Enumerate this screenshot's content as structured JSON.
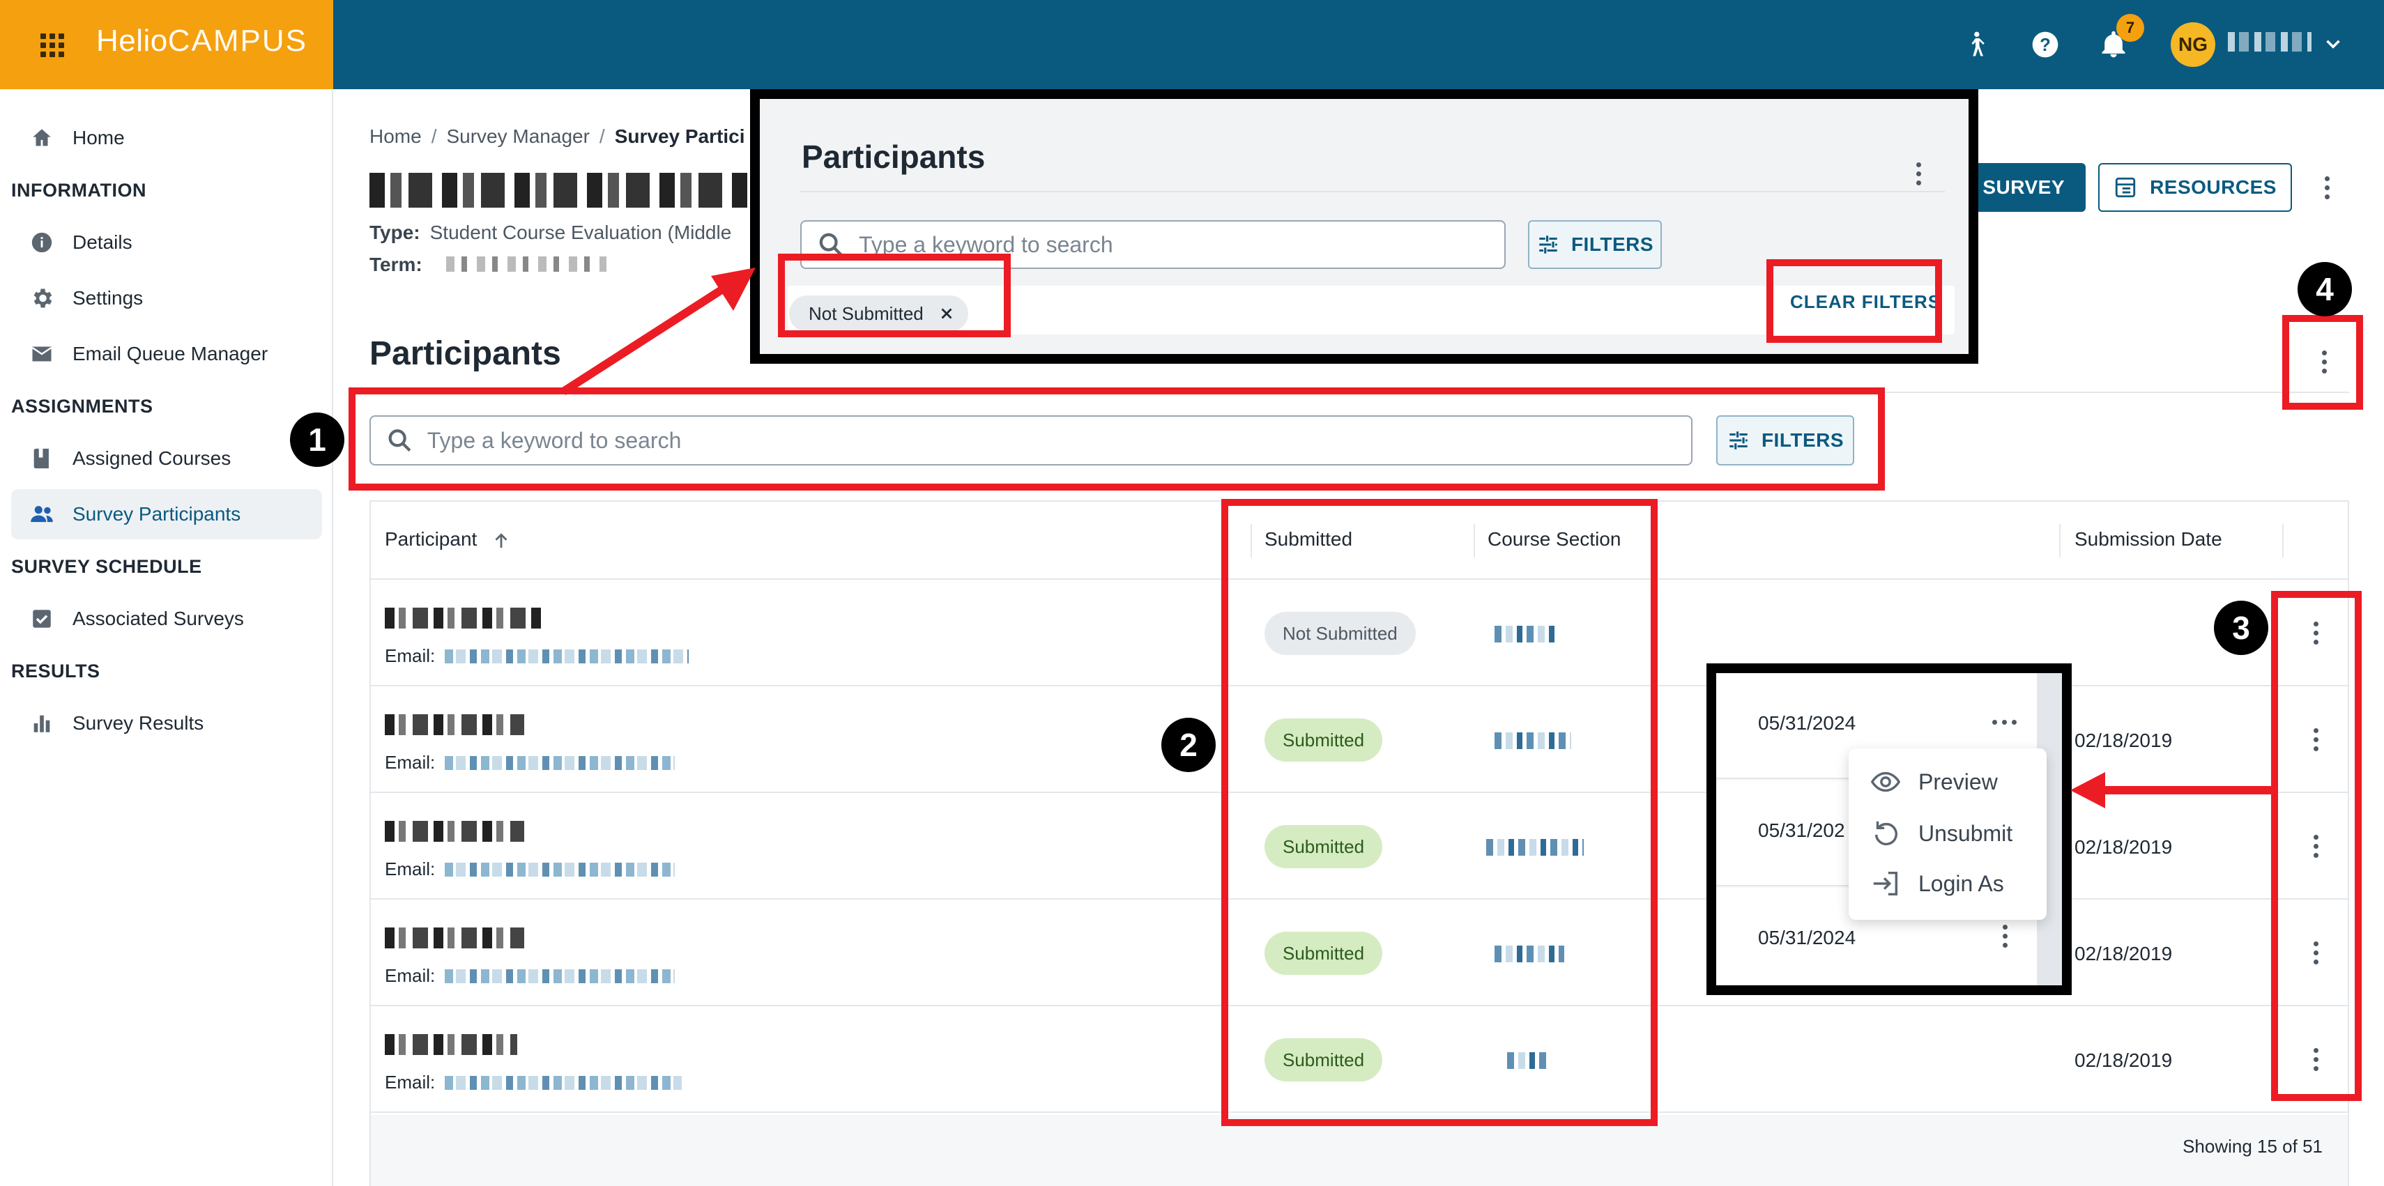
{
  "app": {
    "brand_helio": "Helio",
    "brand_campus": "CAMPUS",
    "notification_count": "7",
    "user_initials": "NG"
  },
  "sidebar": {
    "home": "Home",
    "sections": [
      {
        "heading": "INFORMATION",
        "items": [
          "Details",
          "Settings",
          "Email Queue Manager"
        ]
      },
      {
        "heading": "ASSIGNMENTS",
        "items": [
          "Assigned Courses",
          "Survey Participants"
        ]
      },
      {
        "heading": "SURVEY SCHEDULE",
        "items": [
          "Associated Surveys"
        ]
      },
      {
        "heading": "RESULTS",
        "items": [
          "Survey Results"
        ]
      }
    ],
    "active_item": "Survey Participants"
  },
  "breadcrumb": {
    "home": "Home",
    "survey_manager": "Survey Manager",
    "current": "Survey Partici"
  },
  "survey": {
    "type_label": "Type:",
    "type_value": "Student Course Evaluation (Middle",
    "term_label": "Term:"
  },
  "header_buttons": {
    "primary": "N SURVEY",
    "resources": "RESOURCES"
  },
  "participants": {
    "title": "Participants",
    "search_placeholder": "Type a keyword to search",
    "filters_label": "FILTERS",
    "columns": {
      "participant": "Participant",
      "submitted": "Submitted",
      "course_section": "Course Section",
      "submission_date": "Submission Date"
    },
    "email_label": "Email:",
    "rows": [
      {
        "status": "Not Submitted",
        "submitted": false,
        "submission_date": ""
      },
      {
        "status": "Submitted",
        "submitted": true,
        "submission_date": "02/18/2019"
      },
      {
        "status": "Submitted",
        "submitted": true,
        "submission_date": "02/18/2019"
      },
      {
        "status": "Submitted",
        "submitted": true,
        "submission_date": "02/18/2019"
      },
      {
        "status": "Submitted",
        "submitted": true,
        "submission_date": "02/18/2019"
      }
    ],
    "footer": "Showing 15 of 51"
  },
  "zoom_filters": {
    "title": "Participants",
    "search_placeholder": "Type a keyword to search",
    "filters_label": "FILTERS",
    "chip_label": "Not Submitted",
    "clear_filters": "CLEAR FILTERS"
  },
  "zoom_menu": {
    "dates": [
      "05/31/2024",
      "05/31/202",
      "05/31/2024"
    ],
    "items": [
      "Preview",
      "Unsubmit",
      "Login As"
    ]
  },
  "callouts": [
    "1",
    "2",
    "3",
    "4"
  ],
  "colors": {
    "header_blue": "#0a5a80",
    "brand_orange": "#f5a00f",
    "annotation_red": "#ec1c24",
    "submitted_green": "#d5ecc2"
  }
}
